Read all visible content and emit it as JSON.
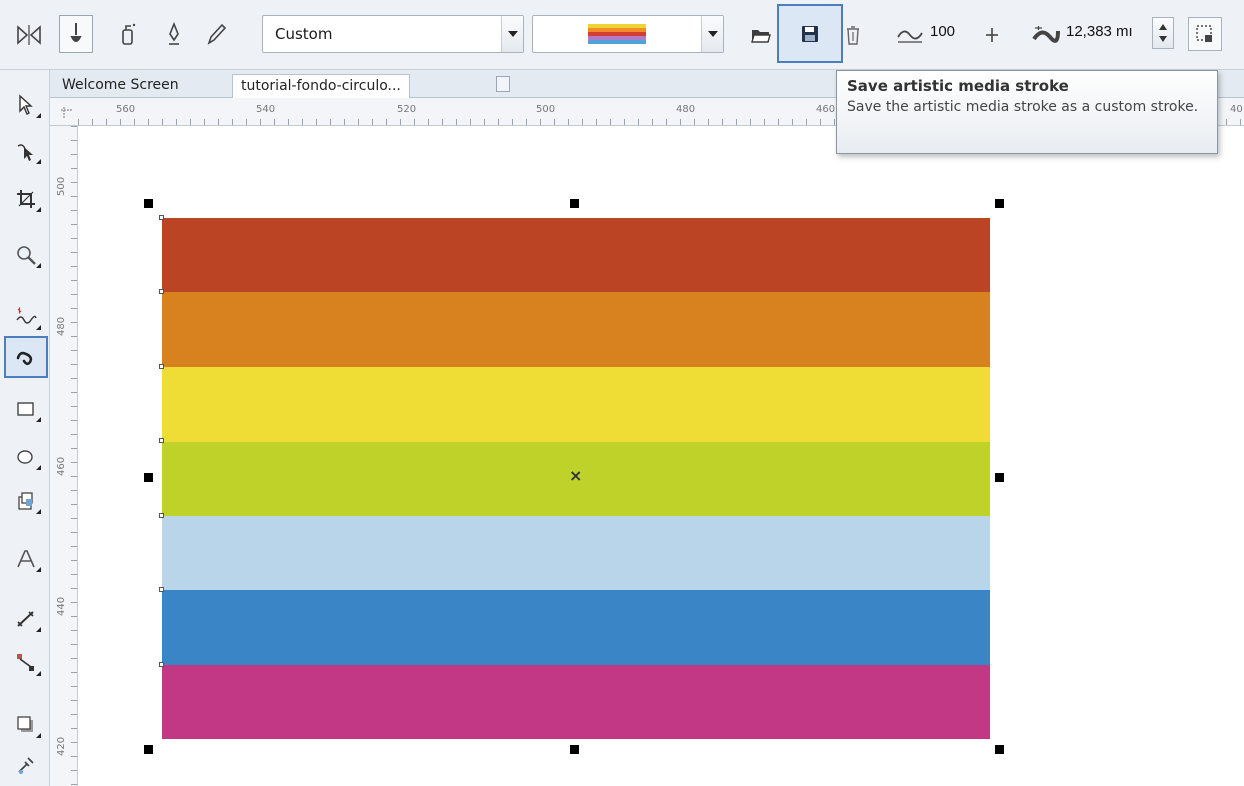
{
  "toolbar": {
    "preset_combo": {
      "value": "Custom"
    },
    "stroke_combo": {
      "swatch_colors": [
        "#f0d230",
        "#ef8e2a",
        "#d33f2f",
        "#b37ac5",
        "#4fa3d8"
      ]
    },
    "smoothing_value": "100",
    "stroke_width_value": "12,383 mm",
    "stroke_width_visible": "12,383 mı",
    "icons": [
      "mirror-icon",
      "brush-icon",
      "sprayer-icon",
      "calligraphic-icon",
      "pen-icon",
      "open-folder-icon",
      "save-icon",
      "delete-icon",
      "smoothing-icon",
      "width-icon",
      "scale-icon"
    ]
  },
  "tabs": [
    {
      "label": "Welcome Screen"
    },
    {
      "label": "tutorial-fondo-circulo..."
    }
  ],
  "rulers": {
    "horizontal": [
      "560",
      "540",
      "520",
      "500",
      "480",
      "460",
      "40"
    ],
    "vertical": [
      "500",
      "480",
      "460",
      "440",
      "420"
    ]
  },
  "tooltip": {
    "title": "Save artistic media stroke",
    "body": "Save the artistic media stroke as a custom stroke."
  },
  "artwork": {
    "stripes": [
      {
        "color": "#bb4425"
      },
      {
        "color": "#d8821f"
      },
      {
        "color": "#efdc35"
      },
      {
        "color": "#bfd22a"
      },
      {
        "color": "#b8d5ea"
      },
      {
        "color": "#3a85c6"
      },
      {
        "color": "#c23884"
      }
    ],
    "center_marker": "×"
  },
  "colors": {
    "accent": "#4a7ebf",
    "toolbar_bg": "#eef2f7"
  }
}
